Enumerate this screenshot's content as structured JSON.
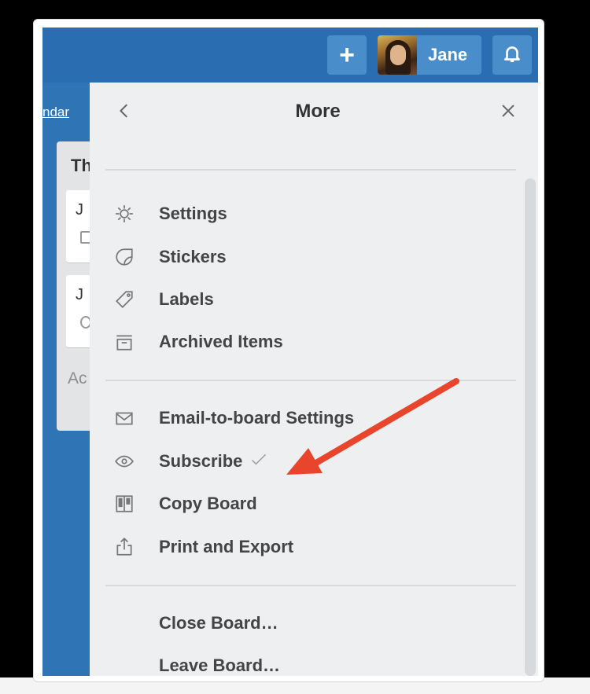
{
  "header": {
    "add_icon": "plus-icon",
    "user_name": "Jane",
    "avatar_icon": "user-avatar",
    "notifications_icon": "bell-icon"
  },
  "board": {
    "calendar_link": "ndar",
    "list_title": "Th",
    "cards": [
      {
        "text": "J",
        "badge_icon": "checklist-icon"
      },
      {
        "text": "J",
        "badge_icon": "comment-icon"
      }
    ],
    "add_card": "Ac"
  },
  "menu": {
    "title": "More",
    "back_icon": "chevron-left-icon",
    "close_icon": "close-icon",
    "items": [
      {
        "label": "Settings",
        "icon": "gear-icon"
      },
      {
        "label": "Stickers",
        "icon": "sticker-icon"
      },
      {
        "label": "Labels",
        "icon": "tag-icon"
      },
      {
        "label": "Archived Items",
        "icon": "archive-icon"
      },
      {
        "label": "Email-to-board Settings",
        "icon": "email-icon"
      },
      {
        "label": "Subscribe",
        "icon": "eye-icon",
        "checked": true
      },
      {
        "label": "Copy Board",
        "icon": "board-icon"
      },
      {
        "label": "Print and Export",
        "icon": "share-icon"
      },
      {
        "label": "Close Board…"
      },
      {
        "label": "Leave Board…"
      }
    ]
  },
  "annotation": {
    "arrow_color": "#e8452c",
    "points_to": "Copy Board"
  },
  "colors": {
    "header": "#2a6db0",
    "board": "#2f74b4",
    "panel": "#edeff0",
    "text": "#444444"
  }
}
